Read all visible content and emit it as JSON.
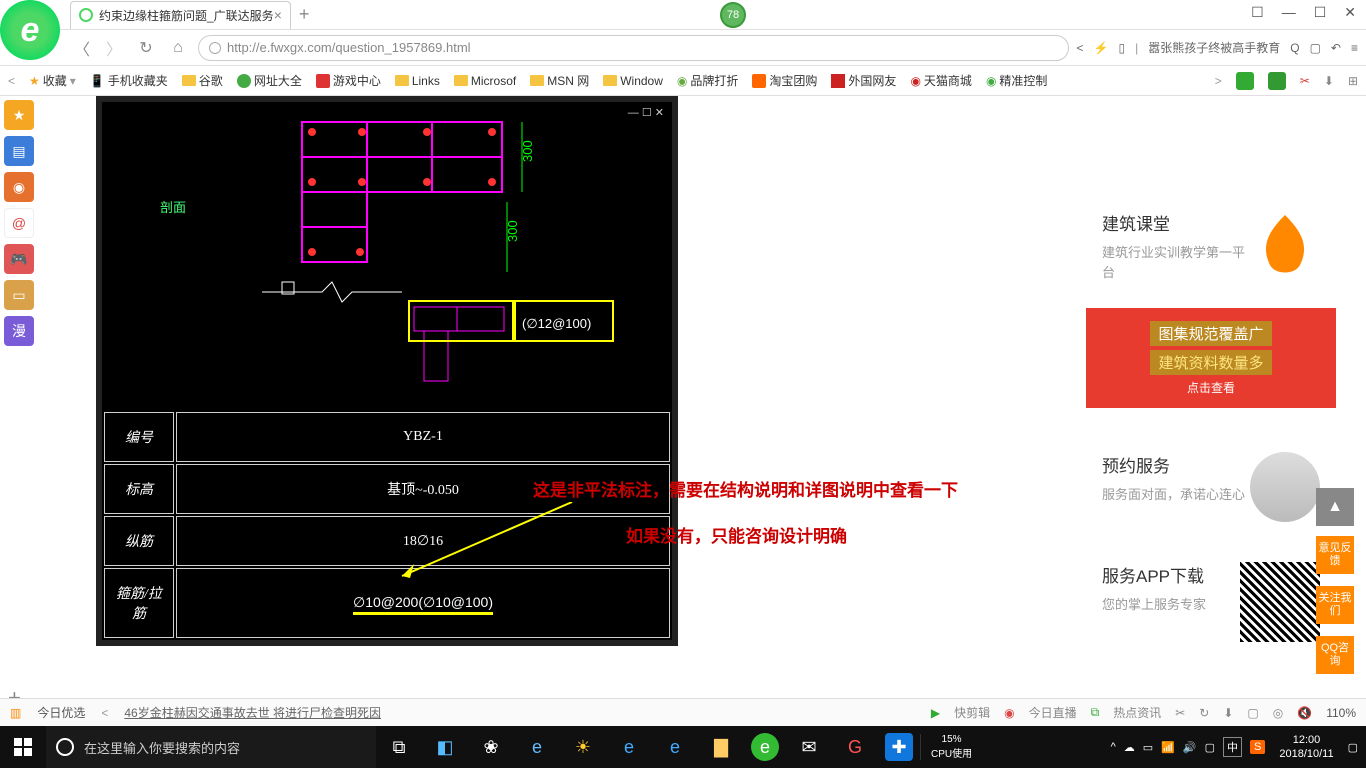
{
  "titlebar": {
    "tab_title": "约束边缘柱箍筋问题_广联达服务",
    "badge": "78"
  },
  "addrbar": {
    "url": "http://e.fwxgx.com/question_1957869.html",
    "search_hint": "嚣张熊孩子终被高手教育"
  },
  "bookmarks": {
    "fav": "收藏",
    "mobile": "手机收藏夹",
    "google": "谷歌",
    "sites": "网址大全",
    "games": "游戏中心",
    "links": "Links",
    "microsoft": "Microsof",
    "msn": "MSN 网",
    "window": "Window",
    "brand": "品牌打折",
    "taobao": "淘宝团购",
    "foreign": "外国网友",
    "tmall": "天猫商城",
    "precise": "精准控制"
  },
  "cad": {
    "section_label": "剖面",
    "dim1": "300",
    "dim2": "300",
    "annot": "(∅12@100)",
    "row1_label": "编号",
    "row1_val": "YBZ-1",
    "row2_label": "标高",
    "row2_val": "基顶~-0.050",
    "row3_label": "纵筋",
    "row3_val": "18∅16",
    "row4_label": "箍筋/拉筋",
    "row4_val": "∅10@200(∅10@100)"
  },
  "notes": {
    "line1": "这是非平法标注，需要在结构说明和详图说明中查看一下",
    "line2": "如果没有，只能咨询设计明确"
  },
  "right": {
    "card1_title": "建筑课堂",
    "card1_desc": "建筑行业实训教学第一平台",
    "banner_l1": "图集规范覆盖广",
    "banner_l2": "建筑资料数量多",
    "banner_btn": "点击查看",
    "card2_title": "预约服务",
    "card2_desc": "服务面对面，承诺心连心",
    "card3_title": "服务APP下载",
    "card3_desc": "您的掌上服务专家"
  },
  "float": {
    "feedback": "意见反馈",
    "follow": "关注我们",
    "qq": "QQ咨询"
  },
  "status": {
    "today": "今日优选",
    "news": "46岁金柱赫因交通事故去世 将进行尸检查明死因",
    "clip": "快剪辑",
    "live": "今日直播",
    "hot": "热点资讯",
    "zoom": "110%"
  },
  "taskbar": {
    "search_placeholder": "在这里输入你要搜索的内容",
    "cpu_pct": "15%",
    "cpu_label": "CPU使用",
    "ime": "中",
    "time": "12:00",
    "date": "2018/10/11"
  }
}
